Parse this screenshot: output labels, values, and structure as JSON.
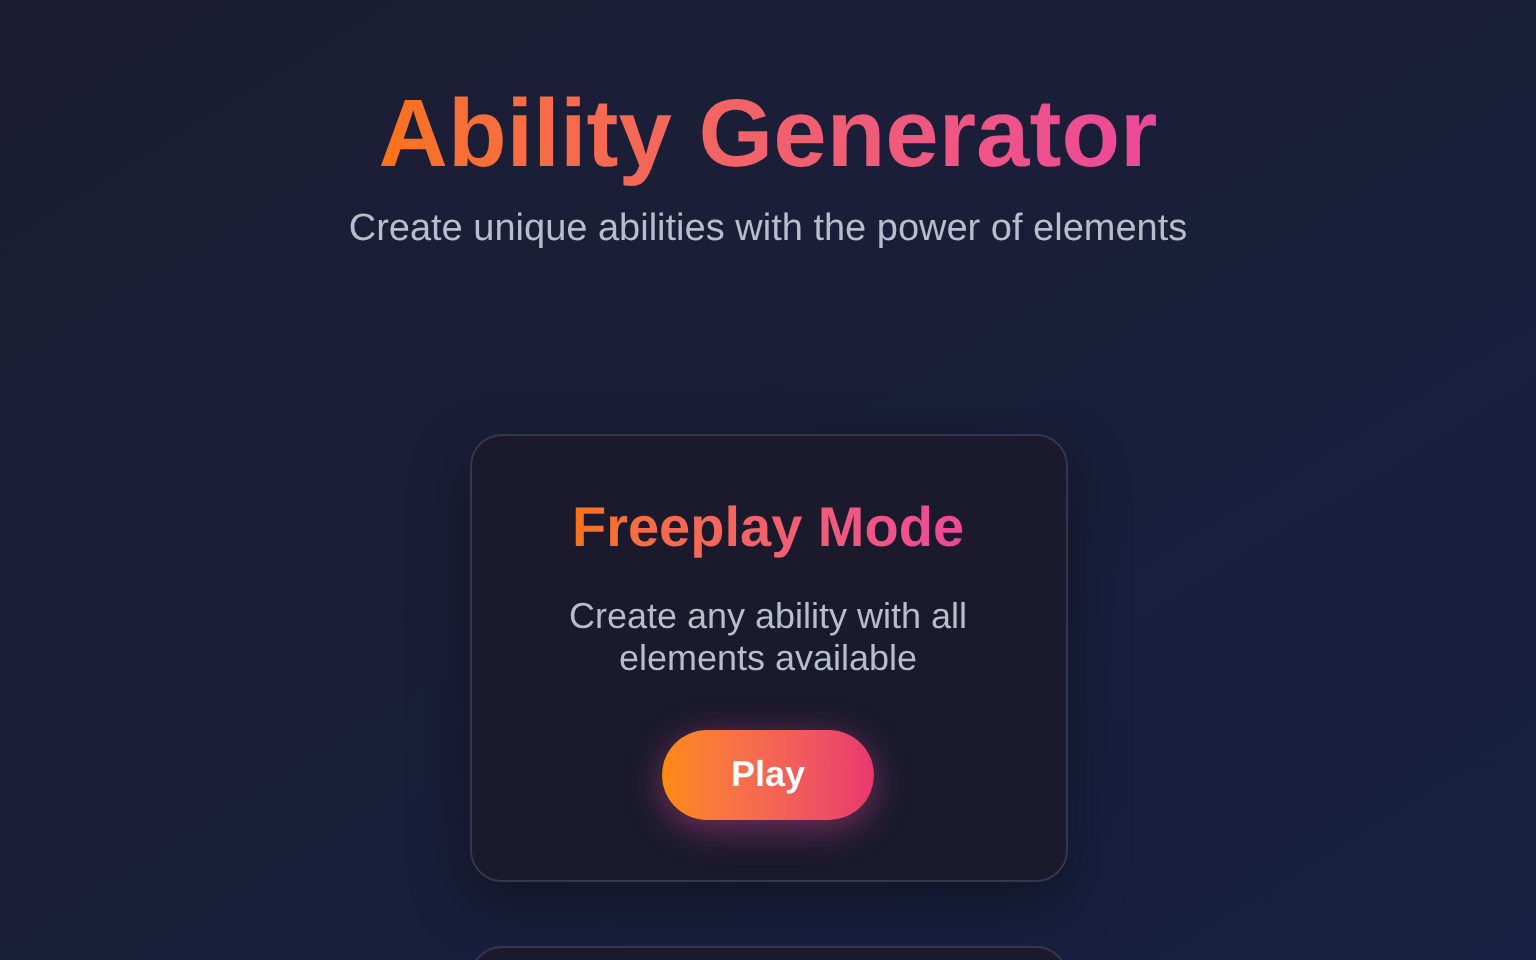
{
  "header": {
    "title": "Ability Generator",
    "subtitle": "Create unique abilities with the power of elements"
  },
  "modes": [
    {
      "title": "Freeplay Mode",
      "description": "Create any ability with all elements available",
      "button": "Play"
    }
  ]
}
